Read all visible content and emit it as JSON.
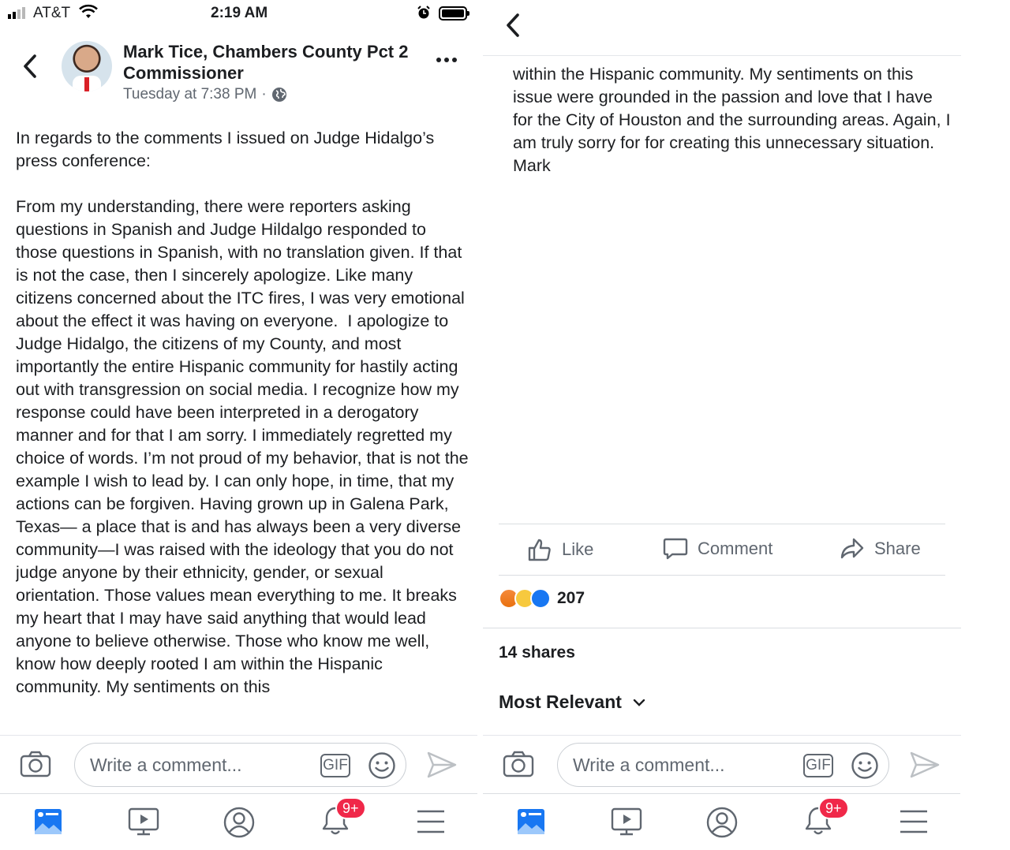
{
  "status_bar": {
    "carrier": "AT&T",
    "time": "2:19 AM"
  },
  "post": {
    "author": "Mark Tice, Chambers County Pct 2 Commissioner",
    "timestamp": "Tuesday at 7:38 PM",
    "separator": "·",
    "paragraph1": "In regards to the comments I issued on Judge Hidalgo’s press conference:",
    "paragraph2": "From my understanding, there were reporters asking questions in Spanish and Judge Hildalgo responded to those questions in Spanish, with no translation given. If that is not the case, then I sincerely apologize. Like many citizens concerned about the ITC fires, I was very emotional about the effect it was having on everyone.  I apologize to Judge Hidalgo, the citizens of my County, and most importantly the entire Hispanic community for hastily acting out with transgression on social media. I recognize how my response could have been interpreted in a derogatory manner and for that I am sorry. I immediately regretted my choice of words. I’m not proud of my behavior, that is not the example I wish to lead by. I can only hope, in time, that my actions can be forgiven. Having grown up in Galena Park, Texas— a place that is and has always been a very diverse community—I was raised with the ideology that you do not judge anyone by their ethnicity, gender, or sexual orientation. Those values mean everything to me. It breaks my heart that I may have said anything that would lead anyone to believe otherwise. Those who know me well, know how deeply rooted I am within the Hispanic community. My sentiments on this",
    "continued_text": "within the Hispanic community. My sentiments on this issue were grounded in the passion and love that I have for the City of Houston and the surrounding areas. Again, I am truly sorry for for creating this unnecessary situation. Mark"
  },
  "actions": {
    "like": "Like",
    "comment": "Comment",
    "share": "Share"
  },
  "reactions": {
    "count": "207",
    "types": [
      "angry",
      "haha",
      "like"
    ]
  },
  "shares": "14 shares",
  "sort": {
    "label": "Most Relevant"
  },
  "composer": {
    "placeholder": "Write a comment...",
    "gif": "GIF"
  },
  "nav": {
    "notifications_badge": "9+"
  },
  "colors": {
    "accent": "#1877f2",
    "badge": "#f02849",
    "secondary_text": "#606770"
  }
}
